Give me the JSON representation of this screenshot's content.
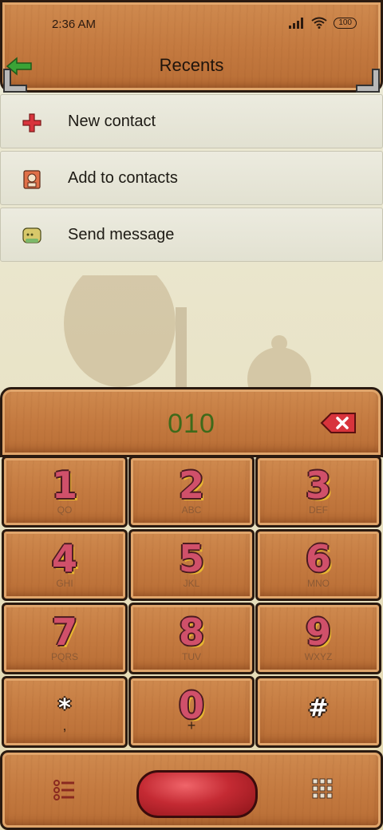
{
  "status_bar": {
    "time": "2:36 AM",
    "battery": "100"
  },
  "header": {
    "title": "Recents"
  },
  "menu": [
    {
      "label": "New contact",
      "icon": "plus-icon"
    },
    {
      "label": "Add to contacts",
      "icon": "contact-card-icon"
    },
    {
      "label": "Send message",
      "icon": "message-icon"
    }
  ],
  "dialer": {
    "number": "010",
    "keys": [
      {
        "digit": "1",
        "letters": "QO"
      },
      {
        "digit": "2",
        "letters": "ABC"
      },
      {
        "digit": "3",
        "letters": "DEF"
      },
      {
        "digit": "4",
        "letters": "GHI"
      },
      {
        "digit": "5",
        "letters": "JKL"
      },
      {
        "digit": "6",
        "letters": "MNO"
      },
      {
        "digit": "7",
        "letters": "PQRS"
      },
      {
        "digit": "8",
        "letters": "TUV"
      },
      {
        "digit": "9",
        "letters": "WXYZ"
      },
      {
        "digit": "*",
        "letters": ","
      },
      {
        "digit": "0",
        "letters": "+"
      },
      {
        "digit": "#",
        "letters": ""
      }
    ]
  },
  "colors": {
    "wood": "#c47a40",
    "number": "#3e6a1a",
    "call": "#c42a33",
    "digit": "#d0506a"
  }
}
